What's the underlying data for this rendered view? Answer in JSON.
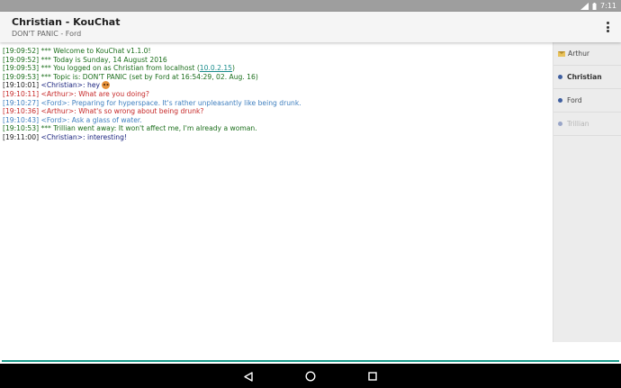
{
  "status_bar": {
    "time": "7:11"
  },
  "app_bar": {
    "title": "Christian - KouChat",
    "subtitle": "DON'T PANIC - Ford",
    "overflow_icon": "more-vert-icon"
  },
  "messages": [
    {
      "ts": "[19:09:52]",
      "text": "*** Welcome to KouChat v1.1.0!",
      "kind": "system"
    },
    {
      "ts": "[19:09:52]",
      "text": "*** Today is Sunday, 14 August 2016",
      "kind": "system"
    },
    {
      "ts": "[19:09:53]",
      "pre": "*** You logged on as Christian from localhost (",
      "link": "10.0.2.15",
      "post": ")",
      "kind": "system"
    },
    {
      "ts": "[19:09:53]",
      "text": "*** Topic is: DON'T PANIC (set by Ford at 16:54:29, 02. Aug. 16)",
      "kind": "system"
    },
    {
      "ts": "[19:10:01]",
      "nick": "<Christian>:",
      "text": "hey",
      "emoji": "smiley-icon",
      "kind": "christian"
    },
    {
      "ts": "[19:10:11]",
      "nick": "<Arthur>:",
      "text": "What are you doing?",
      "kind": "arthur"
    },
    {
      "ts": "[19:10:27]",
      "nick": "<Ford>:",
      "text": "Preparing for hyperspace. It's rather unpleasantly like being drunk.",
      "kind": "ford"
    },
    {
      "ts": "[19:10:36]",
      "nick": "<Arthur>:",
      "text": "What's so wrong about being drunk?",
      "kind": "arthur"
    },
    {
      "ts": "[19:10:43]",
      "nick": "<Ford>:",
      "text": "Ask a glass of water.",
      "kind": "ford"
    },
    {
      "ts": "[19:10:53]",
      "text": "*** Trillian went away: It won't affect me, I'm already a woman.",
      "kind": "system"
    },
    {
      "ts": "[19:11:00]",
      "nick": "<Christian>:",
      "text": "interesting!",
      "kind": "christian"
    }
  ],
  "users": [
    {
      "name": "Arthur",
      "state": "new-message",
      "icon": "envelope-icon"
    },
    {
      "name": "Christian",
      "state": "me",
      "icon": "dot-icon"
    },
    {
      "name": "Ford",
      "state": "normal",
      "icon": "dot-icon"
    },
    {
      "name": "Trillian",
      "state": "away",
      "icon": "dot-icon"
    }
  ],
  "input": {
    "value": "",
    "placeholder": ""
  },
  "nav_bar": {
    "back_icon": "back-triangle-icon",
    "home_icon": "home-circle-icon",
    "recents_icon": "recents-square-icon"
  },
  "colors": {
    "system": "#1b6e1b",
    "christian": "#1a237e",
    "arthur": "#c62828",
    "ford": "#3f7fbf",
    "accent": "#1a9a8a"
  }
}
